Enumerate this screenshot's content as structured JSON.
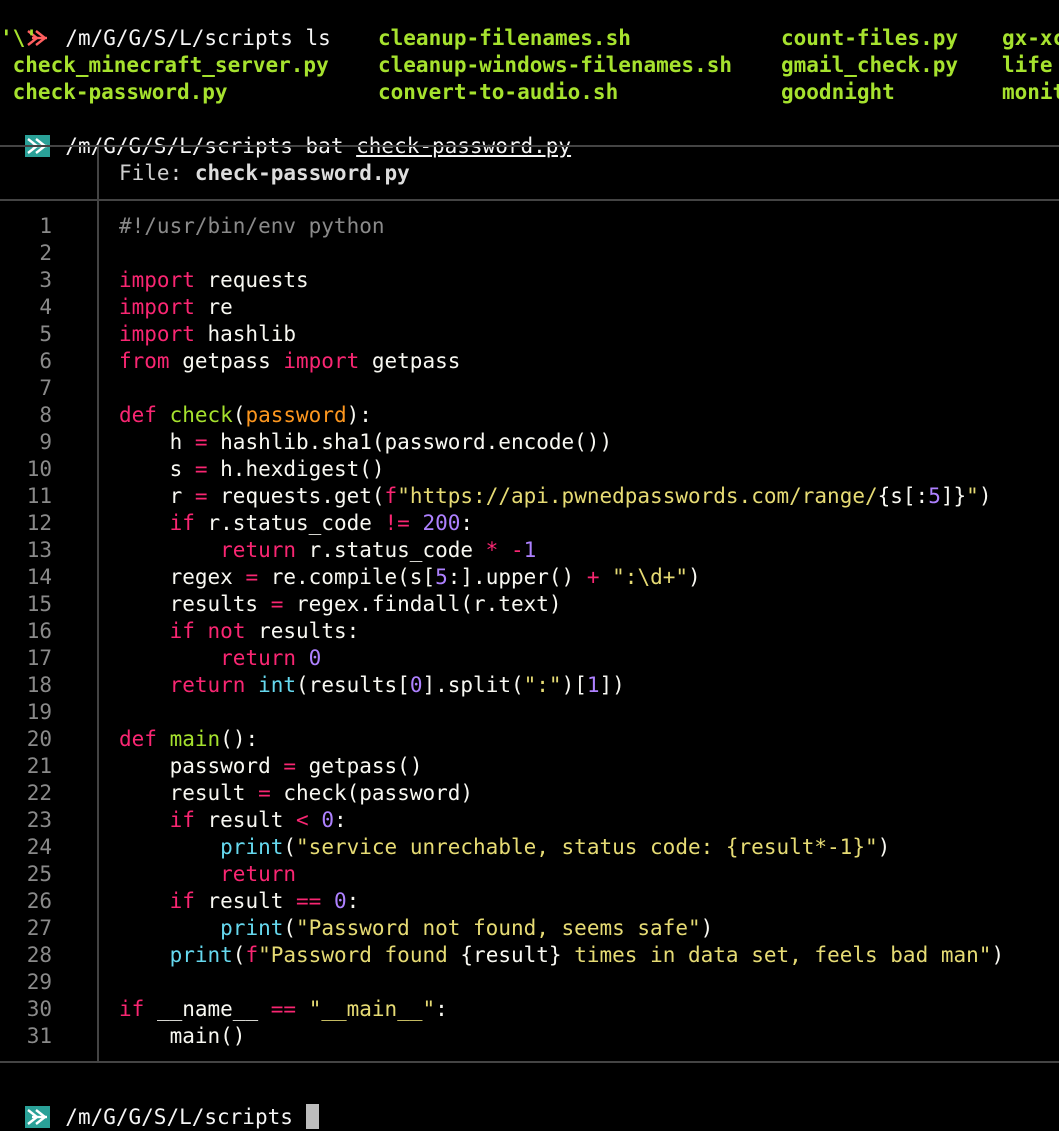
{
  "prompt": {
    "path": "/m/G/G/S/L/scripts",
    "cmd1": "ls",
    "cmd2": "bat",
    "cmd2_arg": "check-password.py"
  },
  "ls_output": [
    [
      "'\\'",
      "cleanup-filenames.sh",
      "count-files.py",
      "gx-xc"
    ],
    [
      " check_minecraft_server.py",
      "cleanup-windows-filenames.sh",
      "gmail_check.py",
      "life"
    ],
    [
      " check-password.py",
      "convert-to-audio.sh",
      "goodnight",
      "monit"
    ]
  ],
  "bat": {
    "file_label": "File: ",
    "file_name": "check-password.py"
  },
  "code_lines": [
    [
      [
        "c",
        "#!/usr/bin/env python"
      ]
    ],
    [],
    [
      [
        "k",
        "import"
      ],
      [
        "",
        " requests"
      ]
    ],
    [
      [
        "k",
        "import"
      ],
      [
        "",
        " re"
      ]
    ],
    [
      [
        "k",
        "import"
      ],
      [
        "",
        " hashlib"
      ]
    ],
    [
      [
        "k",
        "from"
      ],
      [
        "",
        " getpass "
      ],
      [
        "k",
        "import"
      ],
      [
        "",
        " getpass"
      ]
    ],
    [],
    [
      [
        "k",
        "def"
      ],
      [
        "",
        " "
      ],
      [
        "f",
        "check"
      ],
      [
        "",
        "("
      ],
      [
        "p",
        "password"
      ],
      [
        "",
        "):"
      ]
    ],
    [
      [
        "",
        "    h "
      ],
      [
        "k",
        "="
      ],
      [
        "",
        " hashlib.sha1(password.encode())"
      ]
    ],
    [
      [
        "",
        "    s "
      ],
      [
        "k",
        "="
      ],
      [
        "",
        " h.hexdigest()"
      ]
    ],
    [
      [
        "",
        "    r "
      ],
      [
        "k",
        "="
      ],
      [
        "",
        " requests.get("
      ],
      [
        "k",
        "f"
      ],
      [
        "s",
        "\"https://api.pwnedpasswords.com/range/"
      ],
      [
        "",
        "{s[:"
      ],
      [
        "n",
        "5"
      ],
      [
        "",
        "]}"
      ],
      [
        "s",
        "\""
      ],
      [
        "",
        ")"
      ]
    ],
    [
      [
        "",
        "    "
      ],
      [
        "k",
        "if"
      ],
      [
        "",
        " r.status_code "
      ],
      [
        "k",
        "!="
      ],
      [
        "",
        " "
      ],
      [
        "n",
        "200"
      ],
      [
        "",
        ":"
      ]
    ],
    [
      [
        "",
        "        "
      ],
      [
        "k",
        "return"
      ],
      [
        "",
        " r.status_code "
      ],
      [
        "k",
        "*"
      ],
      [
        "",
        " "
      ],
      [
        "k",
        "-"
      ],
      [
        "n",
        "1"
      ]
    ],
    [
      [
        "",
        "    regex "
      ],
      [
        "k",
        "="
      ],
      [
        "",
        " re.compile(s["
      ],
      [
        "n",
        "5"
      ],
      [
        "",
        ":].upper() "
      ],
      [
        "k",
        "+"
      ],
      [
        "",
        " "
      ],
      [
        "s",
        "\":\\d+\""
      ],
      [
        "",
        ")"
      ]
    ],
    [
      [
        "",
        "    results "
      ],
      [
        "k",
        "="
      ],
      [
        "",
        " regex.findall(r.text)"
      ]
    ],
    [
      [
        "",
        "    "
      ],
      [
        "k",
        "if"
      ],
      [
        "",
        " "
      ],
      [
        "k",
        "not"
      ],
      [
        "",
        " results:"
      ]
    ],
    [
      [
        "",
        "        "
      ],
      [
        "k",
        "return"
      ],
      [
        "",
        " "
      ],
      [
        "n",
        "0"
      ]
    ],
    [
      [
        "",
        "    "
      ],
      [
        "k",
        "return"
      ],
      [
        "",
        " "
      ],
      [
        "b",
        "int"
      ],
      [
        "",
        "(results["
      ],
      [
        "n",
        "0"
      ],
      [
        "",
        "].split("
      ],
      [
        "s",
        "\":\""
      ],
      [
        "",
        ")["
      ],
      [
        "n",
        "1"
      ],
      [
        "",
        "])"
      ]
    ],
    [],
    [
      [
        "k",
        "def"
      ],
      [
        "",
        " "
      ],
      [
        "f",
        "main"
      ],
      [
        "",
        "():"
      ]
    ],
    [
      [
        "",
        "    password "
      ],
      [
        "k",
        "="
      ],
      [
        "",
        " getpass()"
      ]
    ],
    [
      [
        "",
        "    result "
      ],
      [
        "k",
        "="
      ],
      [
        "",
        " check(password)"
      ]
    ],
    [
      [
        "",
        "    "
      ],
      [
        "k",
        "if"
      ],
      [
        "",
        " result "
      ],
      [
        "k",
        "<"
      ],
      [
        "",
        " "
      ],
      [
        "n",
        "0"
      ],
      [
        "",
        ":"
      ]
    ],
    [
      [
        "",
        "        "
      ],
      [
        "b",
        "print"
      ],
      [
        "",
        "("
      ],
      [
        "s",
        "\"service unrechable, status code: {result*-1}\""
      ],
      [
        "",
        ")"
      ]
    ],
    [
      [
        "",
        "        "
      ],
      [
        "k",
        "return"
      ]
    ],
    [
      [
        "",
        "    "
      ],
      [
        "k",
        "if"
      ],
      [
        "",
        " result "
      ],
      [
        "k",
        "=="
      ],
      [
        "",
        " "
      ],
      [
        "n",
        "0"
      ],
      [
        "",
        ":"
      ]
    ],
    [
      [
        "",
        "        "
      ],
      [
        "b",
        "print"
      ],
      [
        "",
        "("
      ],
      [
        "s",
        "\"Password not found, seems safe\""
      ],
      [
        "",
        ")"
      ]
    ],
    [
      [
        "",
        "    "
      ],
      [
        "b",
        "print"
      ],
      [
        "",
        "("
      ],
      [
        "k",
        "f"
      ],
      [
        "s",
        "\"Password found "
      ],
      [
        "",
        "{result}"
      ],
      [
        "s",
        " times in data set, feels bad man\""
      ],
      [
        "",
        ")"
      ]
    ],
    [],
    [
      [
        "k",
        "if"
      ],
      [
        "",
        " __name__ "
      ],
      [
        "k",
        "=="
      ],
      [
        "",
        " "
      ],
      [
        "s",
        "\"__main__\""
      ],
      [
        "",
        ":"
      ]
    ],
    [
      [
        "",
        "    main()"
      ]
    ]
  ]
}
